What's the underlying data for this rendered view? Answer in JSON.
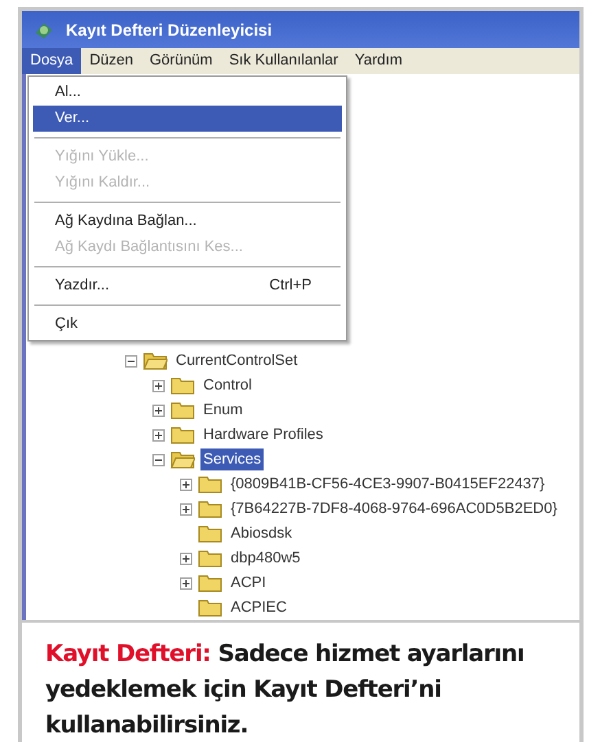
{
  "window": {
    "title": "Kayıt Defteri Düzenleyicisi"
  },
  "menu_bar": [
    {
      "label": "Dosya",
      "selected": true
    },
    {
      "label": "Düzen",
      "selected": false
    },
    {
      "label": "Görünüm",
      "selected": false
    },
    {
      "label": "Sık Kullanılanlar",
      "selected": false
    },
    {
      "label": "Yardım",
      "selected": false
    }
  ],
  "dropdown": [
    {
      "kind": "item",
      "label": "Al...",
      "selected": false,
      "disabled": false
    },
    {
      "kind": "item",
      "label": "Ver...",
      "selected": true,
      "disabled": false
    },
    {
      "kind": "separator"
    },
    {
      "kind": "item",
      "label": "Yığını Yükle...",
      "selected": false,
      "disabled": true
    },
    {
      "kind": "item",
      "label": "Yığını Kaldır...",
      "selected": false,
      "disabled": true
    },
    {
      "kind": "separator"
    },
    {
      "kind": "item",
      "label": "Ağ Kaydına Bağlan...",
      "selected": false,
      "disabled": false
    },
    {
      "kind": "item",
      "label": "Ağ Kaydı Bağlantısını Kes...",
      "selected": false,
      "disabled": true
    },
    {
      "kind": "separator"
    },
    {
      "kind": "item",
      "label": "Yazdır...",
      "shortcut": "Ctrl+P",
      "selected": false,
      "disabled": false
    },
    {
      "kind": "separator"
    },
    {
      "kind": "item",
      "label": "Çık",
      "selected": false,
      "disabled": false
    }
  ],
  "tree": [
    {
      "label": "CurrentControlSet",
      "kind": "expandable",
      "expanded": true,
      "selected": false,
      "children": [
        {
          "label": "Control",
          "kind": "expandable",
          "expanded": false,
          "selected": false
        },
        {
          "label": "Enum",
          "kind": "expandable",
          "expanded": false,
          "selected": false
        },
        {
          "label": "Hardware Profiles",
          "kind": "expandable",
          "expanded": false,
          "selected": false
        },
        {
          "label": "Services",
          "kind": "expandable",
          "expanded": true,
          "selected": true,
          "children": [
            {
              "label": "{0809B41B-CF56-4CE3-9907-B0415EF22437}",
              "kind": "expandable",
              "expanded": false,
              "selected": false
            },
            {
              "label": "{7B64227B-7DF8-4068-9764-696AC0D5B2ED0}",
              "kind": "expandable",
              "expanded": false,
              "selected": false
            },
            {
              "label": "Abiosdsk",
              "kind": "leaf",
              "expanded": false,
              "selected": false
            },
            {
              "label": "dbp480w5",
              "kind": "expandable",
              "expanded": false,
              "selected": false
            },
            {
              "label": "ACPI",
              "kind": "expandable",
              "expanded": false,
              "selected": false
            },
            {
              "label": "ACPIEC",
              "kind": "leaf",
              "expanded": false,
              "selected": false
            }
          ]
        }
      ]
    }
  ],
  "caption": {
    "text": "**Kayıt Defteri:** Sadece hizmet ayarlarını yedeklemek için Kayıt Defteri’ni kullanabilirsiniz."
  }
}
